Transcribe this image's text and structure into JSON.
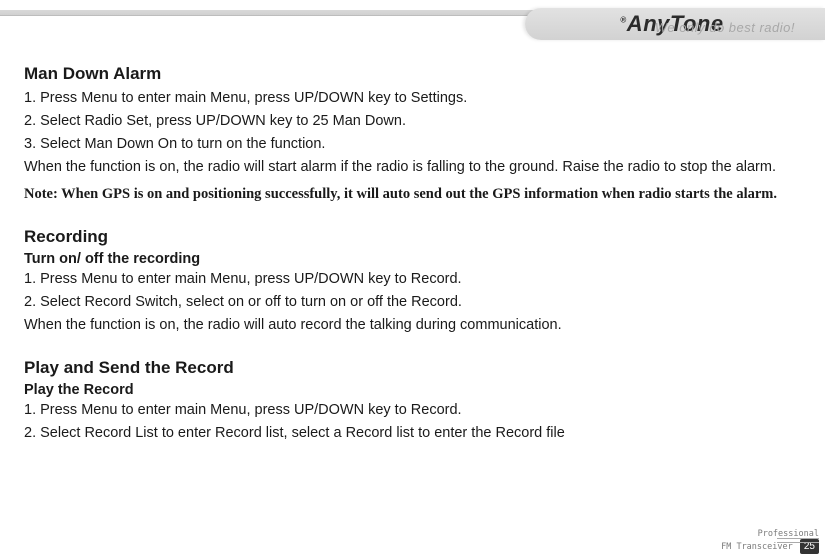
{
  "header": {
    "brand": "AnyTone",
    "tagline": "We only do best radio!",
    "pageDot": "○"
  },
  "sections": [
    {
      "title": "Man Down Alarm",
      "paragraphs": [
        "1. Press Menu to enter main Menu, press UP/DOWN key to Settings.",
        "2. Select Radio Set, press UP/DOWN key to 25 Man Down.",
        "3. Select Man Down On to turn on the function.",
        "When the function is on, the radio will start alarm if the radio is falling to the ground. Raise the radio to stop the alarm."
      ],
      "note": "Note: When GPS is on and positioning successfully, it will auto send out the GPS information when radio starts the alarm."
    },
    {
      "title": "Recording",
      "subtitle": "Turn on/ off the recording",
      "paragraphs": [
        "1. Press Menu to enter main Menu, press UP/DOWN key to Record.",
        "2. Select Record Switch, select on or off to turn on or off the Record.",
        "When the function is on, the radio will auto record the talking during communication."
      ]
    },
    {
      "title": "Play and Send the Record",
      "subtitle": "Play the Record",
      "paragraphs": [
        "1. Press Menu to enter main Menu, press UP/DOWN key to Record.",
        "2. Select Record List to enter Record list, select a Record list to enter the Record file"
      ]
    }
  ],
  "footer": {
    "line1": "Professional",
    "line2": "FM Transceiver",
    "pageNum": "25"
  }
}
